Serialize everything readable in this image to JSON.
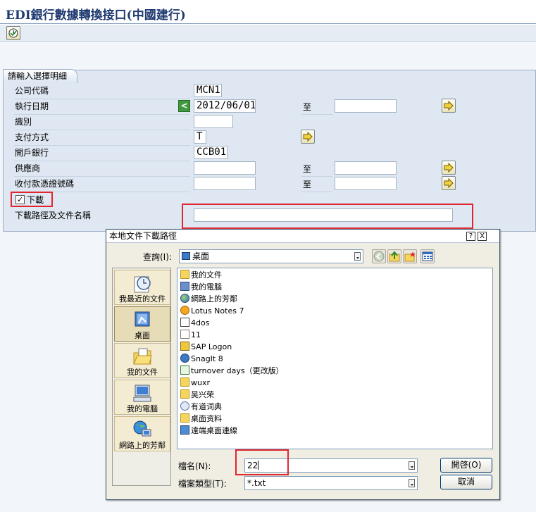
{
  "window": {
    "title": "EDI銀行數據轉換接口(中國建行)"
  },
  "toolbar": {
    "execute_icon": "execute-clock-icon"
  },
  "selection": {
    "tab_label": "請輸入選擇明細",
    "to_label": "至",
    "fields": {
      "company_code": {
        "label": "公司代碼",
        "value": "MCN1"
      },
      "exec_date": {
        "label": "執行日期",
        "value": "2012/06/01",
        "to_value": ""
      },
      "identifier": {
        "label": "識別",
        "value": ""
      },
      "payment_method": {
        "label": "支付方式",
        "value": "T"
      },
      "house_bank": {
        "label": "開戶銀行",
        "value": "CCB01"
      },
      "vendor": {
        "label": "供應商",
        "value": "",
        "to_value": ""
      },
      "doc_number": {
        "label": "收付款憑證號碼",
        "value": "",
        "to_value": ""
      },
      "download": {
        "label": "下載",
        "checked": true
      },
      "download_path": {
        "label": "下載路徑及文件名稱",
        "value": ""
      }
    }
  },
  "dialog": {
    "title": "本地文件下載路徑",
    "lookin_label": "查詢(I):",
    "lookin_value": "桌面",
    "places": [
      {
        "label": "我最近的文件",
        "icon": "recent-clock-icon"
      },
      {
        "label": "桌面",
        "icon": "desktop-icon"
      },
      {
        "label": "我的文件",
        "icon": "my-documents-icon"
      },
      {
        "label": "我的電腦",
        "icon": "my-computer-icon"
      },
      {
        "label": "網路上的芳鄰",
        "icon": "network-places-icon"
      }
    ],
    "files": [
      {
        "name": "我的文件",
        "icon": "folder"
      },
      {
        "name": "我的電腦",
        "icon": "pc"
      },
      {
        "name": "網路上的芳鄰",
        "icon": "net"
      },
      {
        "name": "Lotus Notes 7",
        "icon": "lotus"
      },
      {
        "name": "4dos",
        "icon": "4dos"
      },
      {
        "name": "11",
        "icon": "doc"
      },
      {
        "name": "SAP Logon",
        "icon": "sap"
      },
      {
        "name": "SnagIt 8",
        "icon": "snag"
      },
      {
        "name": "turnover days（更改版）",
        "icon": "xls"
      },
      {
        "name": "wuxr",
        "icon": "folder"
      },
      {
        "name": "吴兴荣",
        "icon": "folder"
      },
      {
        "name": "有道词典",
        "icon": "dict"
      },
      {
        "name": "桌面资料",
        "icon": "folder"
      },
      {
        "name": "遠端桌面連線",
        "icon": "rdp"
      }
    ],
    "filename_label": "檔名(N):",
    "filename_value": "22",
    "filetype_label": "檔案類型(T):",
    "filetype_value": "*.txt",
    "open_button": "開啓(O)",
    "cancel_button": "取消",
    "help_button": "?",
    "close_button": "X"
  }
}
